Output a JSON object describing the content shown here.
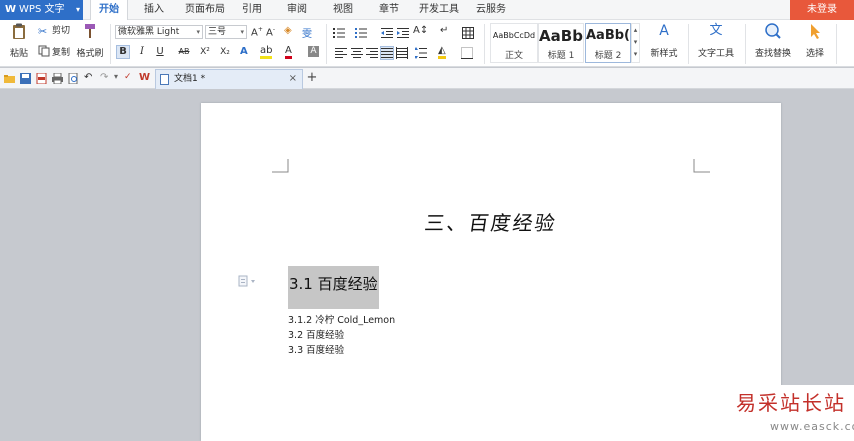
{
  "app": {
    "name": "WPS 文字"
  },
  "menu": {
    "tabs": [
      "开始",
      "插入",
      "页面布局",
      "引用",
      "审阅",
      "视图",
      "章节",
      "开发工具",
      "云服务"
    ],
    "active_tab": 0,
    "login_label": "未登录"
  },
  "ribbon": {
    "paste_label": "粘贴",
    "cut_label": "剪切",
    "copy_label": "复制",
    "format_painter_label": "格式刷",
    "font_name": "微软雅黑 Light",
    "font_size": "三号",
    "bold": "B",
    "italic": "I",
    "underline": "U",
    "strike": "AB",
    "superscript": "X²",
    "subscript": "X₂",
    "styles": [
      {
        "sample": "AaBbCcDd",
        "name": "正文"
      },
      {
        "sample": "AaBb",
        "name": "标题 1"
      },
      {
        "sample": "AaBb(",
        "name": "标题 2"
      }
    ],
    "new_style_label": "新样式",
    "text_tools_label": "文字工具",
    "find_replace_label": "查找替换",
    "select_label": "选择"
  },
  "document_tab": {
    "title": "文档1 *",
    "close": "×",
    "new": "+"
  },
  "document": {
    "chapter_title": "三、百度经验",
    "heading": "3.1 百度经验",
    "paragraphs": [
      "3.1.2 冷柠 Cold_Lemon",
      "3.2 百度经验",
      "3.3 百度经验"
    ]
  },
  "watermark": {
    "main": "易采站长站",
    "url": "www.easck.com"
  },
  "colors": {
    "accent": "#2e6fc8",
    "login_bg": "#e8583b",
    "watermark": "#c3302a"
  }
}
